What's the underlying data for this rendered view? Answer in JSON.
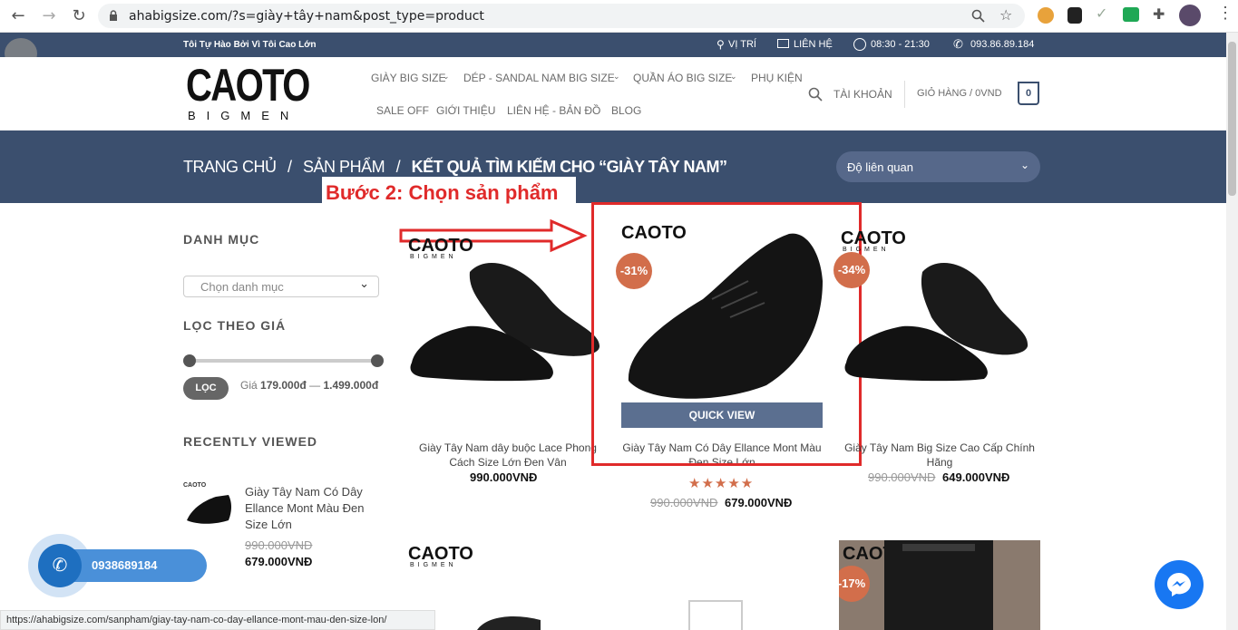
{
  "browser": {
    "url": "ahabigsize.com/?s=giày+tây+nam&post_type=product",
    "status_url": "https://ahabigsize.com/sanpham/giay-tay-nam-co-day-ellance-mont-mau-den-size-lon/"
  },
  "topbar": {
    "slogan": "Tôi Tự Hào Bởi Vì Tôi Cao Lớn",
    "location": "VỊ TRÍ",
    "contact": "LIÊN HỆ",
    "hours": "08:30 - 21:30",
    "phone": "093.86.89.184"
  },
  "logo": {
    "main": "CAOTO",
    "sub": "BIGMEN"
  },
  "nav": {
    "items": [
      "GIÀY BIG SIZE",
      "DÉP - SANDAL NAM BIG SIZE",
      "QUẦN ÁO BIG SIZE",
      "PHỤ KIỆN",
      "SALE OFF",
      "GIỚI THIỆU",
      "LIÊN HỆ - BẢN ĐỒ",
      "BLOG"
    ],
    "account": "TÀI KHOẢN",
    "cart": "GIỎ HÀNG / 0VND",
    "cart_count": "0"
  },
  "breadcrumb": {
    "home": "TRANG CHỦ",
    "sep": "/",
    "products": "SẢN PHẨM",
    "current": "KẾT QUẢ TÌM KIẾM CHO “GIÀY TÂY NAM”"
  },
  "sort": {
    "selected": "Độ liên quan"
  },
  "annotation": {
    "step": "Bước 2: Chọn sản phẩm"
  },
  "sidebar": {
    "category_heading": "DANH MỤC",
    "category_select": "Chọn danh mục",
    "price_heading": "LỌC THEO GIÁ",
    "filter_button": "LỌC",
    "price_label": "Giá",
    "price_min": "179.000đ",
    "price_dash": "—",
    "price_max": "1.499.000đ",
    "recent_heading": "RECENTLY VIEWED",
    "recent_title": "Giày Tây Nam Có Dây Ellance Mont Màu Đen Size Lớn",
    "recent_old": "990.000VNĐ",
    "recent_price": "679.000VNĐ"
  },
  "products": [
    {
      "title": "Giày Tây Nam dây buộc Lace Phong Cách Size Lớn Đen Vân",
      "price": "990.000VNĐ"
    },
    {
      "title": "Giày Tây Nam Có Dây Ellance Mont Màu Đen Size Lớn",
      "badge": "-31%",
      "quickview": "QUICK VIEW",
      "old": "990.000VNĐ",
      "price": "679.000VNĐ",
      "rating": 5
    },
    {
      "title": "Giày Tây Nam Big Size Cao Cấp Chính Hãng",
      "badge": "-34%",
      "old": "990.000VNĐ",
      "price": "649.000VNĐ"
    },
    {
      "badge": "-17%"
    }
  ],
  "callbar": {
    "phone": "0938689184"
  },
  "icons": [
    "back-icon",
    "forward-icon",
    "reload-icon",
    "lock-icon",
    "search-icon",
    "star-icon",
    "extension-icon",
    "pin-icon",
    "mail-icon",
    "clock-icon",
    "phone-icon",
    "chevron-down-icon",
    "messenger-icon",
    "shoe-image"
  ]
}
